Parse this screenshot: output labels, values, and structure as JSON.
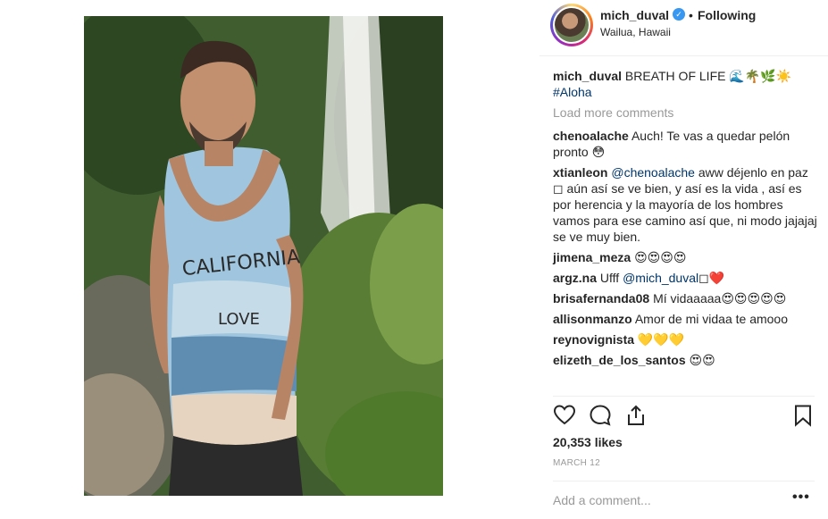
{
  "post": {
    "username": "mich_duval",
    "verified_glyph": "✓",
    "separator": "•",
    "follow_status": "Following",
    "location": "Wailua, Hawaii",
    "photo_icon": "man-in-tank-top-waterfall-photo"
  },
  "caption": {
    "username": "mich_duval",
    "text": "BREATH OF LIFE 🌊🌴🌿☀️",
    "hashtag": "#Aloha"
  },
  "load_more": "Load more comments",
  "comments": [
    {
      "username": "chenoalache",
      "text": "Auch! Te vas a quedar pelón pronto 😳"
    },
    {
      "username": "xtianleon",
      "mention": "@chenoalache",
      "text": "aww déjenlo en paz ◻ aún así se ve bien, y así es la vida , así es por herencia y la mayoría de los hombres vamos para ese camino así que, ni modo jajajaj se ve muy bien."
    },
    {
      "username": "jimena_meza",
      "text": "😍😍😍😍"
    },
    {
      "username": "argz.na",
      "text_before": "Ufff",
      "mention": "@mich_duval",
      "text": "◻❤️"
    },
    {
      "username": "brisafernanda08",
      "text": "Mí vidaaaaa😍😍😍😍😍"
    },
    {
      "username": "allisonmanzo",
      "text": "Amor de mi vidaa te amooo"
    },
    {
      "username": "reynovignista",
      "text": "💛💛💛"
    },
    {
      "username": "elizeth_de_los_santos",
      "text": "😍😍"
    }
  ],
  "actions": {
    "like_icon": "heart-icon",
    "comment_icon": "comment-icon",
    "share_icon": "share-icon",
    "save_icon": "bookmark-icon"
  },
  "likes": "20,353 likes",
  "date": "MARCH 12",
  "add_comment_placeholder": "Add a comment...",
  "more_label": "•••",
  "colors": {
    "link": "#003569",
    "muted": "#999999",
    "verified": "#3897f0",
    "text": "#262626"
  }
}
